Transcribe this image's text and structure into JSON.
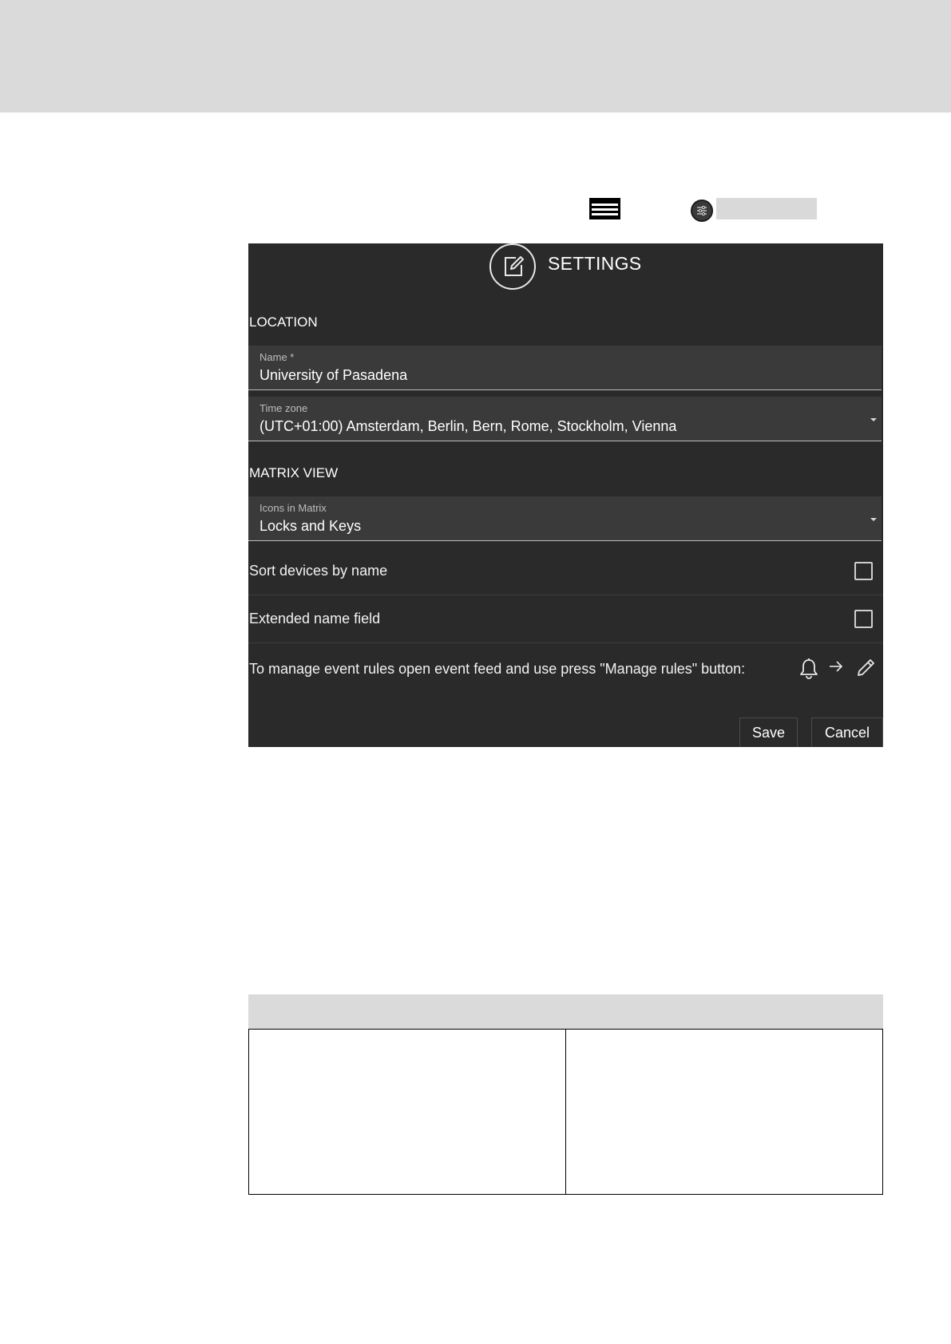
{
  "top_band": {
    "color": "#dadada"
  },
  "toolbar": {
    "menu_icon": "hamburger-menu-icon",
    "filter_icon": "filter-sliders-icon"
  },
  "settings": {
    "header_icon": "edit-note-icon",
    "title": "SETTINGS",
    "location": {
      "section_title": "LOCATION",
      "name_label": "Name *",
      "name_value": "University of Pasadena",
      "timezone_label": "Time zone",
      "timezone_value": "(UTC+01:00) Amsterdam, Berlin, Bern, Rome, Stockholm, Vienna"
    },
    "matrix_view": {
      "section_title": "MATRIX VIEW",
      "icons_label": "Icons in Matrix",
      "icons_value": "Locks and Keys",
      "sort_label": "Sort devices by name",
      "sort_checked": false,
      "extended_label": "Extended name field",
      "extended_checked": false
    },
    "rules_text": "To manage event rules open event feed and use press \"Manage rules\" button:",
    "rules_icons": [
      "bell-icon",
      "arrow-right-icon",
      "pencil-icon"
    ],
    "buttons": {
      "save": "Save",
      "cancel": "Cancel"
    },
    "colors": {
      "panel_bg": "#2a2a2a",
      "field_bg": "#3a3a3a",
      "text": "#ffffff"
    }
  },
  "table": {
    "header_color": "#dadada",
    "columns": 2
  }
}
